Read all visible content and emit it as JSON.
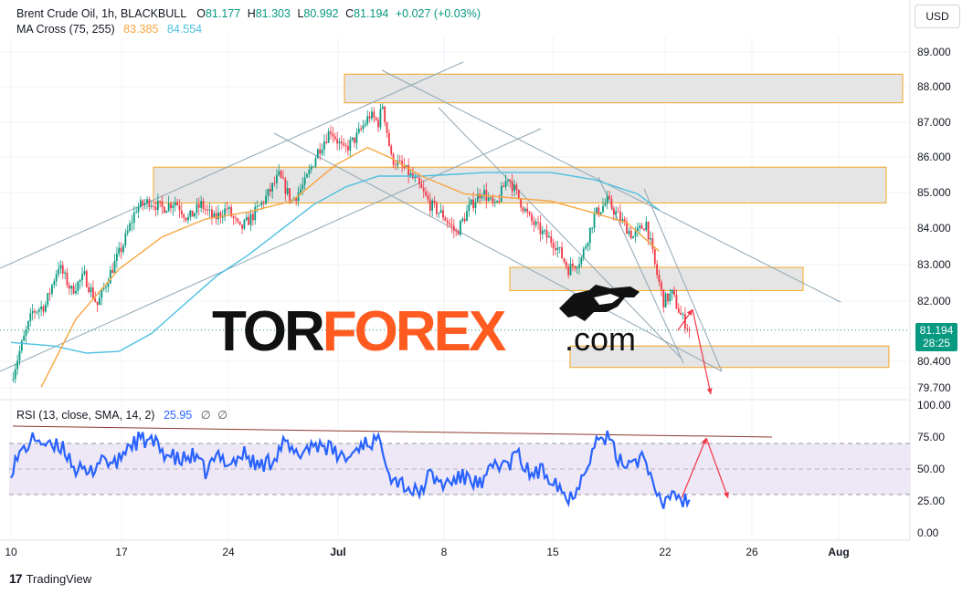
{
  "header": {
    "symbol": "Brent Crude Oil, 1h, BLACKBULL",
    "open_label": "O",
    "open": "81.177",
    "high_label": "H",
    "high": "81.303",
    "low_label": "L",
    "low": "80.992",
    "close_label": "C",
    "close": "81.194",
    "change": "+0.027 (+0.03%)",
    "ma_label": "MA Cross (75, 255)",
    "ma_fast": "83.385",
    "ma_slow": "84.554"
  },
  "currency_button": "USD",
  "current_price": "81.194",
  "countdown": "28:25",
  "watermark": {
    "part1": "TOR",
    "part2": "FOREX",
    "part3": ".com"
  },
  "rsi_header": {
    "label": "RSI (13, close, SMA, 14, 2)",
    "value": "25.95",
    "na1": "∅",
    "na2": "∅"
  },
  "branding": "TradingView",
  "colors": {
    "up": "#089981",
    "down": "#f23645",
    "ma_fast": "#f7a540",
    "ma_slow": "#4cc0e0",
    "rsi": "#2962ff",
    "zone_border": "#f5a623",
    "zone_fill": "#e0e0e0",
    "forecast": "#f23645",
    "trend": "#8fa6b3"
  },
  "chart_data": {
    "type": "candlestick",
    "price_axis_labels": [
      "89.000",
      "88.000",
      "87.000",
      "86.000",
      "85.000",
      "84.000",
      "83.000",
      "82.000",
      "80.400",
      "79.700"
    ],
    "date_axis_labels": [
      "10",
      "17",
      "24",
      "Jul",
      "8",
      "15",
      "22",
      "26",
      "Aug"
    ],
    "rsi_axis_labels": [
      "100.00",
      "75.00",
      "50.00",
      "25.00",
      "0.00"
    ],
    "ylim": [
      79.4,
      89.4
    ],
    "rsi_ylim": [
      0,
      100
    ],
    "price_path": [
      [
        0,
        79.8
      ],
      [
        4,
        80.6
      ],
      [
        10,
        81.7
      ],
      [
        16,
        81.9
      ],
      [
        22,
        83.0
      ],
      [
        28,
        82.3
      ],
      [
        34,
        82.7
      ],
      [
        40,
        81.9
      ],
      [
        46,
        82.8
      ],
      [
        52,
        83.6
      ],
      [
        58,
        84.6
      ],
      [
        64,
        84.8
      ],
      [
        70,
        84.6
      ],
      [
        76,
        84.8
      ],
      [
        82,
        84.3
      ],
      [
        88,
        84.7
      ],
      [
        94,
        84.3
      ],
      [
        100,
        84.6
      ],
      [
        106,
        84.0
      ],
      [
        112,
        84.4
      ],
      [
        118,
        84.9
      ],
      [
        124,
        85.5
      ],
      [
        130,
        84.8
      ],
      [
        136,
        85.3
      ],
      [
        142,
        86.2
      ],
      [
        148,
        86.8
      ],
      [
        154,
        86.2
      ],
      [
        160,
        86.6
      ],
      [
        166,
        87.2
      ],
      [
        170,
        87.0
      ],
      [
        172,
        87.5
      ],
      [
        176,
        86.0
      ],
      [
        182,
        85.7
      ],
      [
        188,
        85.3
      ],
      [
        194,
        84.7
      ],
      [
        200,
        84.4
      ],
      [
        206,
        83.9
      ],
      [
        212,
        84.6
      ],
      [
        218,
        85.1
      ],
      [
        224,
        84.6
      ],
      [
        230,
        85.5
      ],
      [
        234,
        85.0
      ],
      [
        240,
        84.3
      ],
      [
        246,
        83.9
      ],
      [
        252,
        83.6
      ],
      [
        258,
        82.9
      ],
      [
        264,
        83.2
      ],
      [
        270,
        84.4
      ],
      [
        276,
        84.8
      ],
      [
        282,
        84.3
      ],
      [
        288,
        83.8
      ],
      [
        294,
        84.2
      ],
      [
        298,
        83.0
      ],
      [
        302,
        82.0
      ],
      [
        306,
        82.2
      ],
      [
        310,
        81.6
      ],
      [
        314,
        81.19
      ]
    ],
    "ma75_path": [
      [
        14,
        79.6
      ],
      [
        30,
        81.5
      ],
      [
        50,
        82.9
      ],
      [
        70,
        83.8
      ],
      [
        90,
        84.3
      ],
      [
        110,
        84.5
      ],
      [
        130,
        84.8
      ],
      [
        150,
        85.8
      ],
      [
        165,
        86.3
      ],
      [
        176,
        86.0
      ],
      [
        190,
        85.5
      ],
      [
        210,
        85.0
      ],
      [
        230,
        84.9
      ],
      [
        250,
        84.8
      ],
      [
        268,
        84.5
      ],
      [
        285,
        84.2
      ],
      [
        300,
        83.4
      ]
    ],
    "ma255_path": [
      [
        0,
        80.85
      ],
      [
        20,
        80.75
      ],
      [
        35,
        80.55
      ],
      [
        50,
        80.6
      ],
      [
        65,
        81.1
      ],
      [
        80,
        81.9
      ],
      [
        95,
        82.7
      ],
      [
        110,
        83.3
      ],
      [
        125,
        84.0
      ],
      [
        140,
        84.7
      ],
      [
        155,
        85.2
      ],
      [
        170,
        85.5
      ],
      [
        190,
        85.5
      ],
      [
        220,
        85.6
      ],
      [
        250,
        85.6
      ],
      [
        270,
        85.4
      ],
      [
        290,
        85.0
      ],
      [
        300,
        84.55
      ]
    ],
    "rsi_path": [
      [
        0,
        50
      ],
      [
        6,
        66
      ],
      [
        12,
        75
      ],
      [
        18,
        66
      ],
      [
        24,
        68
      ],
      [
        30,
        50
      ],
      [
        36,
        45
      ],
      [
        42,
        60
      ],
      [
        48,
        52
      ],
      [
        54,
        68
      ],
      [
        60,
        73
      ],
      [
        66,
        70
      ],
      [
        72,
        62
      ],
      [
        78,
        56
      ],
      [
        84,
        60
      ],
      [
        90,
        48
      ],
      [
        96,
        60
      ],
      [
        102,
        55
      ],
      [
        108,
        62
      ],
      [
        114,
        52
      ],
      [
        120,
        56
      ],
      [
        126,
        70
      ],
      [
        132,
        60
      ],
      [
        138,
        68
      ],
      [
        144,
        70
      ],
      [
        150,
        62
      ],
      [
        156,
        58
      ],
      [
        162,
        70
      ],
      [
        168,
        72
      ],
      [
        172,
        68
      ],
      [
        176,
        45
      ],
      [
        182,
        38
      ],
      [
        188,
        30
      ],
      [
        194,
        45
      ],
      [
        200,
        38
      ],
      [
        206,
        42
      ],
      [
        212,
        44
      ],
      [
        218,
        36
      ],
      [
        224,
        55
      ],
      [
        230,
        52
      ],
      [
        234,
        62
      ],
      [
        240,
        46
      ],
      [
        246,
        48
      ],
      [
        252,
        42
      ],
      [
        258,
        25
      ],
      [
        264,
        43
      ],
      [
        270,
        70
      ],
      [
        276,
        75
      ],
      [
        282,
        55
      ],
      [
        288,
        57
      ],
      [
        294,
        60
      ],
      [
        298,
        28
      ],
      [
        302,
        22
      ],
      [
        306,
        33
      ],
      [
        310,
        26
      ],
      [
        314,
        25.95
      ]
    ],
    "rsi_current": 25.95,
    "resistance_zones": [
      [
        87.55,
        88.35
      ],
      [
        84.75,
        85.75
      ],
      [
        82.3,
        82.95
      ],
      [
        80.15,
        80.75
      ]
    ]
  }
}
